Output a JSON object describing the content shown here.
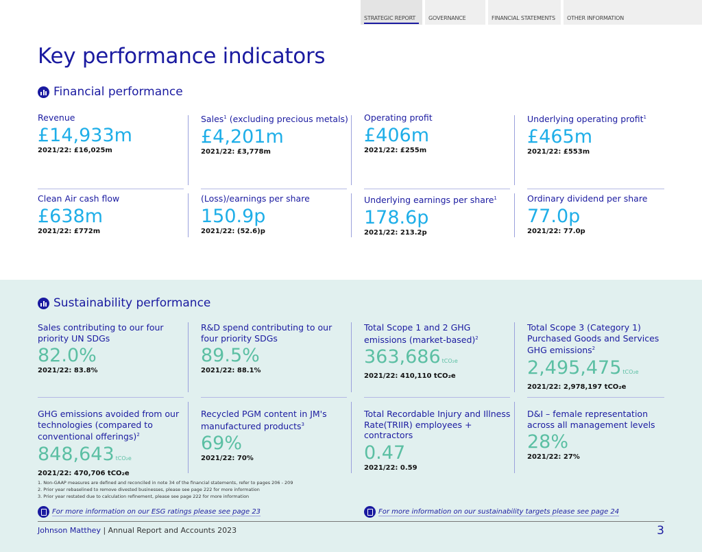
{
  "nav": [
    "STRATEGIC REPORT",
    "GOVERNANCE",
    "FINANCIAL STATEMENTS",
    "OTHER INFORMATION"
  ],
  "title": "Key performance indicators",
  "financial": {
    "heading": "Financial performance",
    "items": [
      {
        "label": "Revenue",
        "sup": "",
        "value": "£14,933m",
        "prior": "2021/22: £16,025m"
      },
      {
        "label": "Sales",
        "sup": "1",
        "label2": " (excluding precious metals)",
        "value": "£4,201m",
        "prior": "2021/22: £3,778m"
      },
      {
        "label": "Operating profit",
        "sup": "",
        "value": "£406m",
        "prior": "2021/22: £255m"
      },
      {
        "label": "Underlying operating profit",
        "sup": "1",
        "value": "£465m",
        "prior": "2021/22: £553m"
      },
      {
        "label": "Clean Air cash flow",
        "sup": "",
        "value": "£638m",
        "prior": "2021/22: £772m"
      },
      {
        "label": "(Loss)/earnings per share",
        "sup": "",
        "value": "150.9p",
        "prior": "2021/22: (52.6)p"
      },
      {
        "label": "Underlying earnings per share",
        "sup": "1",
        "value": "178.6p",
        "prior": "2021/22: 213.2p"
      },
      {
        "label": "Ordinary dividend per share",
        "sup": "",
        "value": "77.0p",
        "prior": "2021/22: 77.0p"
      }
    ]
  },
  "sustainability": {
    "heading": "Sustainability performance",
    "items": [
      {
        "label": "Sales contributing to our four priority UN SDGs",
        "sup": "",
        "value": "82.0%",
        "unit": "",
        "prior": "2021/22: 83.8%"
      },
      {
        "label": "R&D spend contributing to our four priority SDGs",
        "sup": "",
        "value": "89.5%",
        "unit": "",
        "prior": "2021/22: 88.1%"
      },
      {
        "label": "Total Scope 1 and 2 GHG emissions (market-based)",
        "sup": "2",
        "value": "363,686",
        "unit": "tCO₂e",
        "prior": "2021/22: 410,110 tCO₂e"
      },
      {
        "label": "Total Scope 3 (Category 1) Purchased Goods and Services GHG emissions",
        "sup": "2",
        "value": "2,495,475",
        "unit": "tCO₂e",
        "prior": "2021/22: 2,978,197 tCO₂e"
      },
      {
        "label": "GHG emissions avoided from our technologies (compared to conventional offerings)",
        "sup": "2",
        "value": "848,643",
        "unit": "tCO₂e",
        "prior": "2021/22: 470,706 tCO₂e"
      },
      {
        "label": "Recycled PGM content in JM's manufactured products",
        "sup": "3",
        "value": "69%",
        "unit": "",
        "prior": "2021/22: 70%"
      },
      {
        "label": "Total Recordable Injury and Illness Rate(TRIIR) employees + contractors",
        "sup": "",
        "value": "0.47",
        "unit": "",
        "prior": "2021/22: 0.59"
      },
      {
        "label": "D&I – female representation across all management levels",
        "sup": "",
        "value": "28%",
        "unit": "",
        "prior": "2021/22: 27%"
      }
    ]
  },
  "notes": [
    "1.  Non-GAAP measures are defined and reconciled in note 34 of the financial statements, refer to pages 206 - 209",
    "2.  Prior year rebaselined to remove divested businesses, please see page 222 for more information",
    "3.  Prior year restated due to calculation refinement, please see page 222 for more information"
  ],
  "links": [
    "For more information on our ESG ratings please see page 23",
    "For more information on our sustainability targets please see page 24"
  ],
  "footer": {
    "brand": "Johnson Matthey",
    "rest": " | Annual Report and Accounts 2023",
    "page": "3"
  },
  "colors": {
    "navy": "#1a1aa0",
    "financial_value": "#1eaee8",
    "sustainability_value": "#5bbfa3",
    "band": "#e1f0ef"
  }
}
